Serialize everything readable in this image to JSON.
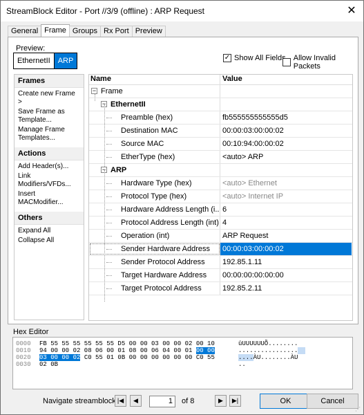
{
  "window": {
    "title": "StreamBlock Editor - Port //3/9 (offline) : ARP Request",
    "close_glyph": "✕"
  },
  "tabs": [
    {
      "label": "General"
    },
    {
      "label": "Frame"
    },
    {
      "label": "Groups"
    },
    {
      "label": "Rx Port"
    },
    {
      "label": "Preview"
    }
  ],
  "preview": {
    "label": "Preview:",
    "items": [
      "EthernetII",
      "ARP"
    ]
  },
  "options": {
    "show_all_fields": "Show All Fields",
    "show_all_checked": "✓",
    "allow_invalid": "Allow Invalid Packets"
  },
  "sidebar": {
    "frames": {
      "title": "Frames",
      "items": [
        "Create new Frame >",
        "Save Frame as Template...",
        "Manage Frame Templates..."
      ]
    },
    "actions": {
      "title": "Actions",
      "items": [
        "Add Header(s)...",
        "Link Modifiers/VFDs...",
        "Insert MACModifier..."
      ]
    },
    "others": {
      "title": "Others",
      "items": [
        "Expand All",
        "Collapse All"
      ]
    }
  },
  "grid": {
    "col_name": "Name",
    "col_value": "Value",
    "frame": "Frame",
    "ethernet": {
      "title": "EthernetII",
      "rows": [
        {
          "name": "Preamble (hex)",
          "value": "fb555555555555d5"
        },
        {
          "name": "Destination MAC",
          "value": "00:00:03:00:00:02"
        },
        {
          "name": "Source MAC",
          "value": "00:10:94:00:00:02"
        },
        {
          "name": "EtherType (hex)",
          "value": "<auto> ARP"
        }
      ]
    },
    "arp": {
      "title": "ARP",
      "rows": [
        {
          "name": "Hardware Type (hex)",
          "value": "<auto> Ethernet"
        },
        {
          "name": "Protocol Type (hex)",
          "value": "<auto> Internet IP"
        },
        {
          "name": "Hardware Address Length (i...",
          "value": "6"
        },
        {
          "name": "Protocol Address Length (int)",
          "value": "4"
        },
        {
          "name": "Operation (int)",
          "value": "ARP Request"
        },
        {
          "name": "Sender Hardware Address",
          "value": "00:00:03:00:00:02"
        },
        {
          "name": "Sender Protocol Address",
          "value": "192.85.1.11"
        },
        {
          "name": "Target Hardware Address",
          "value": "00:00:00:00:00:00"
        },
        {
          "name": "Target Protocol Address",
          "value": "192.85.2.11"
        }
      ]
    }
  },
  "hex_editor": {
    "label": "Hex Editor",
    "rows": [
      {
        "offset": "0000",
        "bytes": "FB 55 55 55 55 55 55 D5 00 00 03 00 00 02 00 10",
        "ascii": "ûUUUUUUÕ........"
      },
      {
        "offset": "0010",
        "bytes_pre": "94 00 00 02 08 06 00 01 08 00 06 04 00 01 ",
        "bytes_hl": "00 00",
        "ascii_pre": "................",
        "ascii_hl": ""
      },
      {
        "offset": "0020",
        "bytes_hl": "03 00 00 02",
        "bytes_post": " C0 55 01 0B 00 00 00 00 00 00 C0 55",
        "ascii_hl": "....",
        "ascii_post": "ÀU........ÀU"
      },
      {
        "offset": "0030",
        "bytes": "02 0B",
        "ascii": ".."
      }
    ]
  },
  "navigation": {
    "label": "Navigate streamblocks:",
    "first": "|◀",
    "prev": "◀",
    "page": "1",
    "of": "of 8",
    "next": "▶",
    "last": "▶|"
  },
  "buttons": {
    "ok": "OK",
    "cancel": "Cancel"
  }
}
